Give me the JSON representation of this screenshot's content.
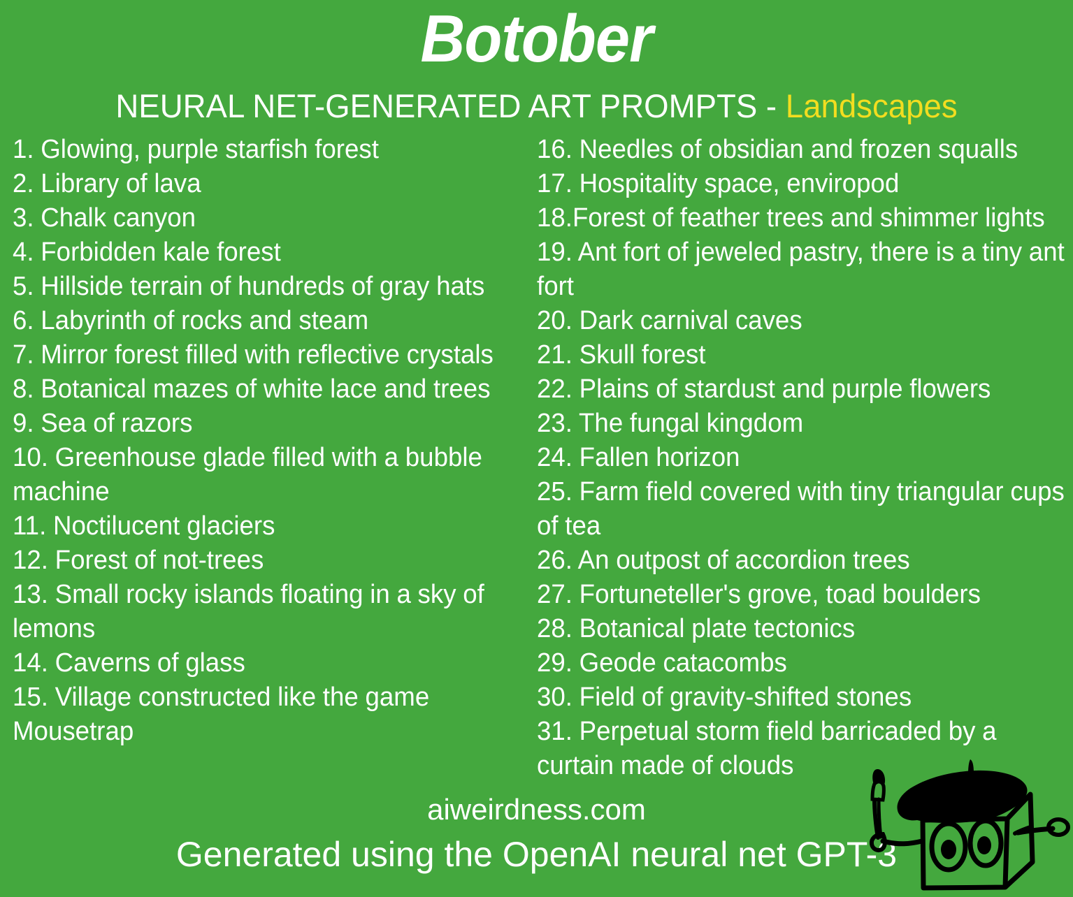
{
  "theme": {
    "background_green": "#44a83e",
    "text_white": "#ffffff",
    "accent_yellow": "#f2dd20",
    "ink_black": "#000000"
  },
  "header": {
    "title": "Botober",
    "subtitle_main": "NEURAL NET-GENERATED ART PROMPTS - ",
    "subtitle_accent": "Landscapes"
  },
  "prompts": {
    "left_column": [
      "1. Glowing, purple starfish forest",
      "2. Library of lava",
      "3. Chalk canyon",
      "4. Forbidden kale forest",
      "5. Hillside terrain of hundreds of gray hats",
      "6. Labyrinth of rocks and steam",
      "7. Mirror forest filled with reflective crystals",
      "8. Botanical mazes of white lace and trees",
      "9. Sea of razors",
      "10. Greenhouse glade filled with a bubble machine",
      "11. Noctilucent glaciers",
      "12. Forest of not-trees",
      "13. Small rocky islands floating in a sky of lemons",
      "14. Caverns of glass",
      "15. Village constructed like the game Mousetrap"
    ],
    "right_column": [
      "16. Needles of obsidian and frozen squalls",
      "17. Hospitality space, enviropod",
      "18.Forest of feather trees and shimmer lights",
      "19. Ant fort of jeweled pastry, there is a tiny ant fort",
      "20. Dark carnival caves",
      "21. Skull forest",
      "22. Plains of stardust and purple flowers",
      "23. The fungal kingdom",
      "24. Fallen horizon",
      "25. Farm field covered with tiny triangular cups of tea",
      "26. An outpost of accordion trees",
      "27. Fortuneteller's grove, toad boulders",
      "28. Botanical plate tectonics",
      "29. Geode catacombs",
      "30. Field of gravity-shifted stones",
      "31. Perpetual storm field barricaded by a curtain made of clouds"
    ]
  },
  "footer": {
    "site": "aiweirdness.com",
    "credit": "Generated using the OpenAI neural net GPT-3"
  },
  "mascot": {
    "description": "robot-with-beret-and-paintbrush"
  }
}
